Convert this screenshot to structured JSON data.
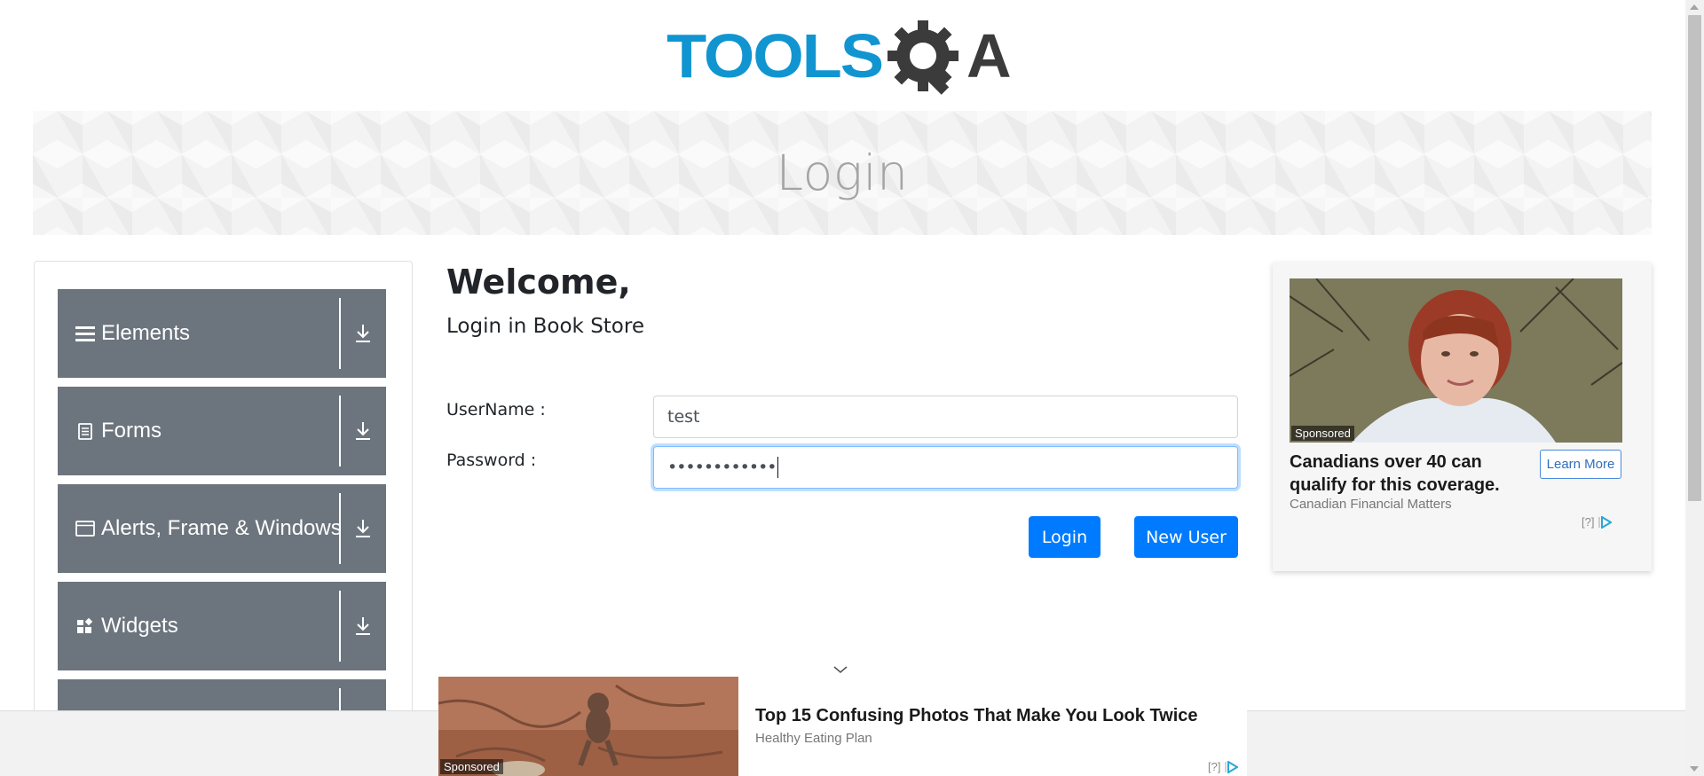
{
  "header": {
    "logo_text": "TOOLSQA",
    "logo_colors": {
      "tools": "#1195d1",
      "qa": "#3b3b3b"
    }
  },
  "banner": {
    "title": "Login"
  },
  "sidebar": {
    "groups": [
      {
        "label": "Elements",
        "icon": "hamburger-icon"
      },
      {
        "label": "Forms",
        "icon": "document-icon"
      },
      {
        "label": "Alerts, Frame & Windows",
        "icon": "window-icon"
      },
      {
        "label": "Widgets",
        "icon": "widgets-grid-icon"
      },
      {
        "label": "",
        "icon": ""
      }
    ]
  },
  "main": {
    "welcome": "Welcome,",
    "subtitle": "Login in Book Store",
    "username_label": "UserName :",
    "username_value": "test",
    "password_label": "Password :",
    "password_value": "••••••••••••",
    "login_button": "Login",
    "new_user_button": "New User"
  },
  "ad_right": {
    "sponsored": "Sponsored",
    "headline": "Canadians over 40 can qualify for this coverage.",
    "source": "Canadian Financial Matters",
    "cta": "Learn More",
    "choices": "[?]"
  },
  "ad_bottom": {
    "sponsored": "Sponsored",
    "headline": "Top 15 Confusing Photos That Make You Look Twice",
    "source": "Healthy Eating Plan",
    "choices": "[?]"
  },
  "colors": {
    "primary": "#007bff",
    "sidebar_group": "#6c757d",
    "banner_text": "#a4a4a4"
  }
}
